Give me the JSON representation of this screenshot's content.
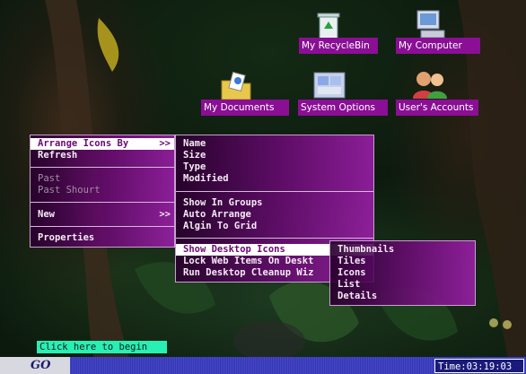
{
  "desktop_icons": [
    {
      "label": "My RecycleBin",
      "icon": "recycle-bin-icon"
    },
    {
      "label": "My Computer",
      "icon": "computer-icon"
    },
    {
      "label": "My Documents",
      "icon": "documents-folder-icon"
    },
    {
      "label": "System Options",
      "icon": "system-options-icon"
    },
    {
      "label": "User's Accounts",
      "icon": "user-accounts-icon"
    }
  ],
  "context_menu": {
    "items": [
      {
        "label": "Arrange Icons By",
        "arrow": ">>",
        "highlighted": true
      },
      {
        "label": "Refresh"
      },
      {
        "label": "Past",
        "disabled": true
      },
      {
        "label": "Past Shourt",
        "disabled": true
      },
      {
        "label": "New",
        "arrow": ">>"
      },
      {
        "label": "Properties"
      }
    ]
  },
  "arrange_submenu": {
    "items": [
      {
        "label": "Name"
      },
      {
        "label": "Size"
      },
      {
        "label": "Type"
      },
      {
        "label": "Modified"
      },
      {
        "label": "Show In Groups"
      },
      {
        "label": "Auto Arrange"
      },
      {
        "label": "Algin To Grid"
      },
      {
        "label": "Show Desktop Icons",
        "highlighted": true
      },
      {
        "label": "Lock Web Items On Deskt"
      },
      {
        "label": "Run Desktop Cleanup Wiz"
      }
    ]
  },
  "view_submenu": {
    "items": [
      {
        "label": "Thumbnails"
      },
      {
        "label": "Tiles"
      },
      {
        "label": "Icons"
      },
      {
        "label": "List"
      },
      {
        "label": "Details"
      }
    ]
  },
  "start": {
    "hint": "Click here to begin",
    "go_label": "GO"
  },
  "clock": {
    "text": "Time:03:19:03"
  },
  "colors": {
    "label_bg": "#8a0f95",
    "start_hint_bg": "#28f0b4",
    "taskbar": "#3a3cc0",
    "menu_highlight": "#ffffff"
  }
}
